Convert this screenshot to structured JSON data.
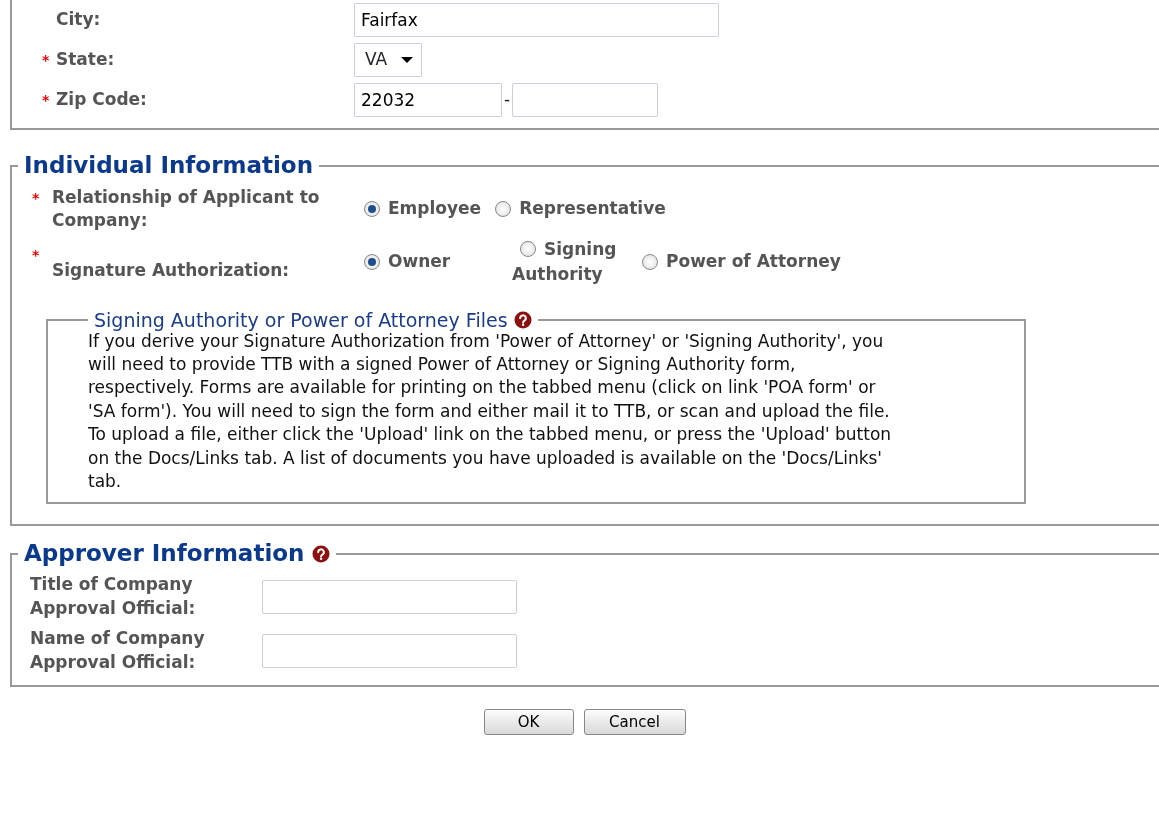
{
  "address": {
    "fields": [
      {
        "label": "City:",
        "kind": "text",
        "value": "Fairfax"
      },
      {
        "label": "State:",
        "required_mark": "*",
        "kind": "select",
        "value": "VA"
      },
      {
        "label": "Zip Code:",
        "required_mark": "*",
        "kind": "zip",
        "value": "22032",
        "separator": "-"
      }
    ]
  },
  "individual": {
    "legend": "Individual Information",
    "questions": [
      {
        "label": "Relationship of Applicant to Company:",
        "required_mark": "*",
        "options": [
          {
            "label": "Employee",
            "selected": true
          },
          {
            "label": "Representative",
            "selected": false
          }
        ]
      },
      {
        "label": "Signature Authorization:",
        "required_mark": "*",
        "options": [
          {
            "label": "Owner",
            "selected": true
          },
          {
            "label": "Signing Authority",
            "selected": false
          },
          {
            "label": "Power of Attorney",
            "selected": false
          }
        ]
      }
    ],
    "files": {
      "legend": "Signing Authority or Power of Attorney Files",
      "help": true,
      "text": "If you derive your Signature Authorization from 'Power of Attorney' or 'Signing Authority', you will need to provide TTB with a signed Power of Attorney or Signing Authority form, respectively. Forms are available for printing on the tabbed menu (click on link 'POA form' or 'SA form'). You will need to sign the form and either mail it to TTB, or scan and upload the file. To upload a file, either click the 'Upload' link on the tabbed menu, or press the 'Upload' button on the Docs/Links tab. A list of documents you have uploaded is available on the 'Docs/Links' tab."
    }
  },
  "approver": {
    "legend": "Approver Information",
    "help": true,
    "fields": [
      {
        "label": "Title of Company Approval Official:"
      },
      {
        "label": "Name of Company Approval Official:"
      }
    ]
  },
  "buttons": [
    "OK",
    "Cancel"
  ]
}
